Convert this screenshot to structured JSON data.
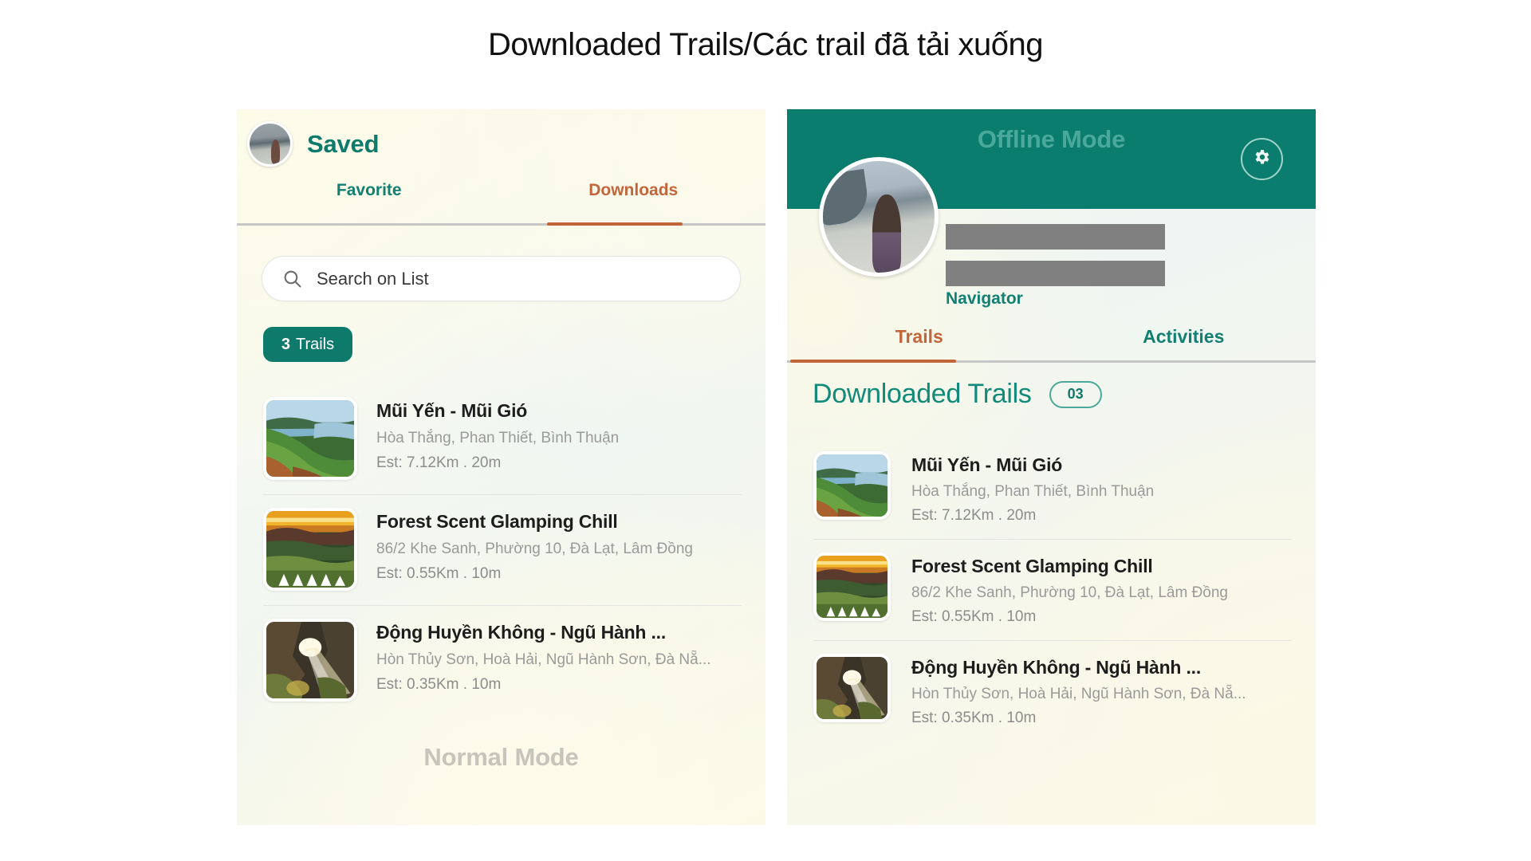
{
  "page": {
    "title": "Downloaded Trails/Các trail đã tải xuống"
  },
  "colors": {
    "teal": "#0d7a6b",
    "teal_light": "#4aa99a",
    "orange": "#c2653a",
    "grey_redact": "#808080",
    "muted": "#9a9a9a",
    "normal_mode_grey": "#c6c4bb"
  },
  "left_panel": {
    "header": {
      "avatar": "user-avatar",
      "title": "Saved"
    },
    "tabs": [
      {
        "label": "Favorite",
        "active": false
      },
      {
        "label": "Downloads",
        "active": true
      }
    ],
    "search": {
      "icon": "search-icon",
      "placeholder": "Search on List",
      "value": ""
    },
    "count_badge": {
      "count": "3",
      "label": "Trails"
    },
    "trails": [
      {
        "title": "Mũi Yến - Mũi Gió",
        "location": "Hòa Thắng, Phan Thiết, Bình Thuận",
        "est": "Est: 7.12Km .  20m",
        "thumb": "coastal-green-cliff"
      },
      {
        "title": "Forest Scent Glamping Chill",
        "location": "86/2 Khe Sanh, Phường 10, Đà Lạt, Lâm Đồng",
        "est": "Est: 0.55Km .  10m",
        "thumb": "sunset-glamping-tents"
      },
      {
        "title": "Động Huyền Không - Ngũ Hành ...",
        "location": "Hòn Thủy Sơn, Hoà Hải, Ngũ Hành Sơn, Đà Nẵ...",
        "est": "Est: 0.35Km .  10m",
        "thumb": "cave-light-beam"
      }
    ],
    "footer_label": "Normal Mode"
  },
  "right_panel": {
    "header": {
      "title": "Offline Mode",
      "settings_icon": "gear-icon"
    },
    "profile": {
      "avatar": "user-avatar-large",
      "name_redacted": "",
      "handle_redacted": "",
      "role": "Navigator"
    },
    "tabs": [
      {
        "label": "Trails",
        "active": true
      },
      {
        "label": "Activities",
        "active": false
      }
    ],
    "section": {
      "heading": "Downloaded Trails",
      "count": "03"
    },
    "trails": [
      {
        "title": "Mũi Yến - Mũi Gió",
        "location": "Hòa Thắng, Phan Thiết, Bình Thuận",
        "est": "Est: 7.12Km .  20m",
        "thumb": "coastal-green-cliff"
      },
      {
        "title": "Forest Scent Glamping Chill",
        "location": "86/2 Khe Sanh, Phường 10, Đà Lạt, Lâm Đồng",
        "est": "Est: 0.55Km .  10m",
        "thumb": "sunset-glamping-tents"
      },
      {
        "title": "Động Huyền Không - Ngũ Hành ...",
        "location": "Hòn Thủy Sơn, Hoà Hải, Ngũ Hành Sơn, Đà Nẵ...",
        "est": "Est: 0.35Km .  10m",
        "thumb": "cave-light-beam"
      }
    ]
  }
}
